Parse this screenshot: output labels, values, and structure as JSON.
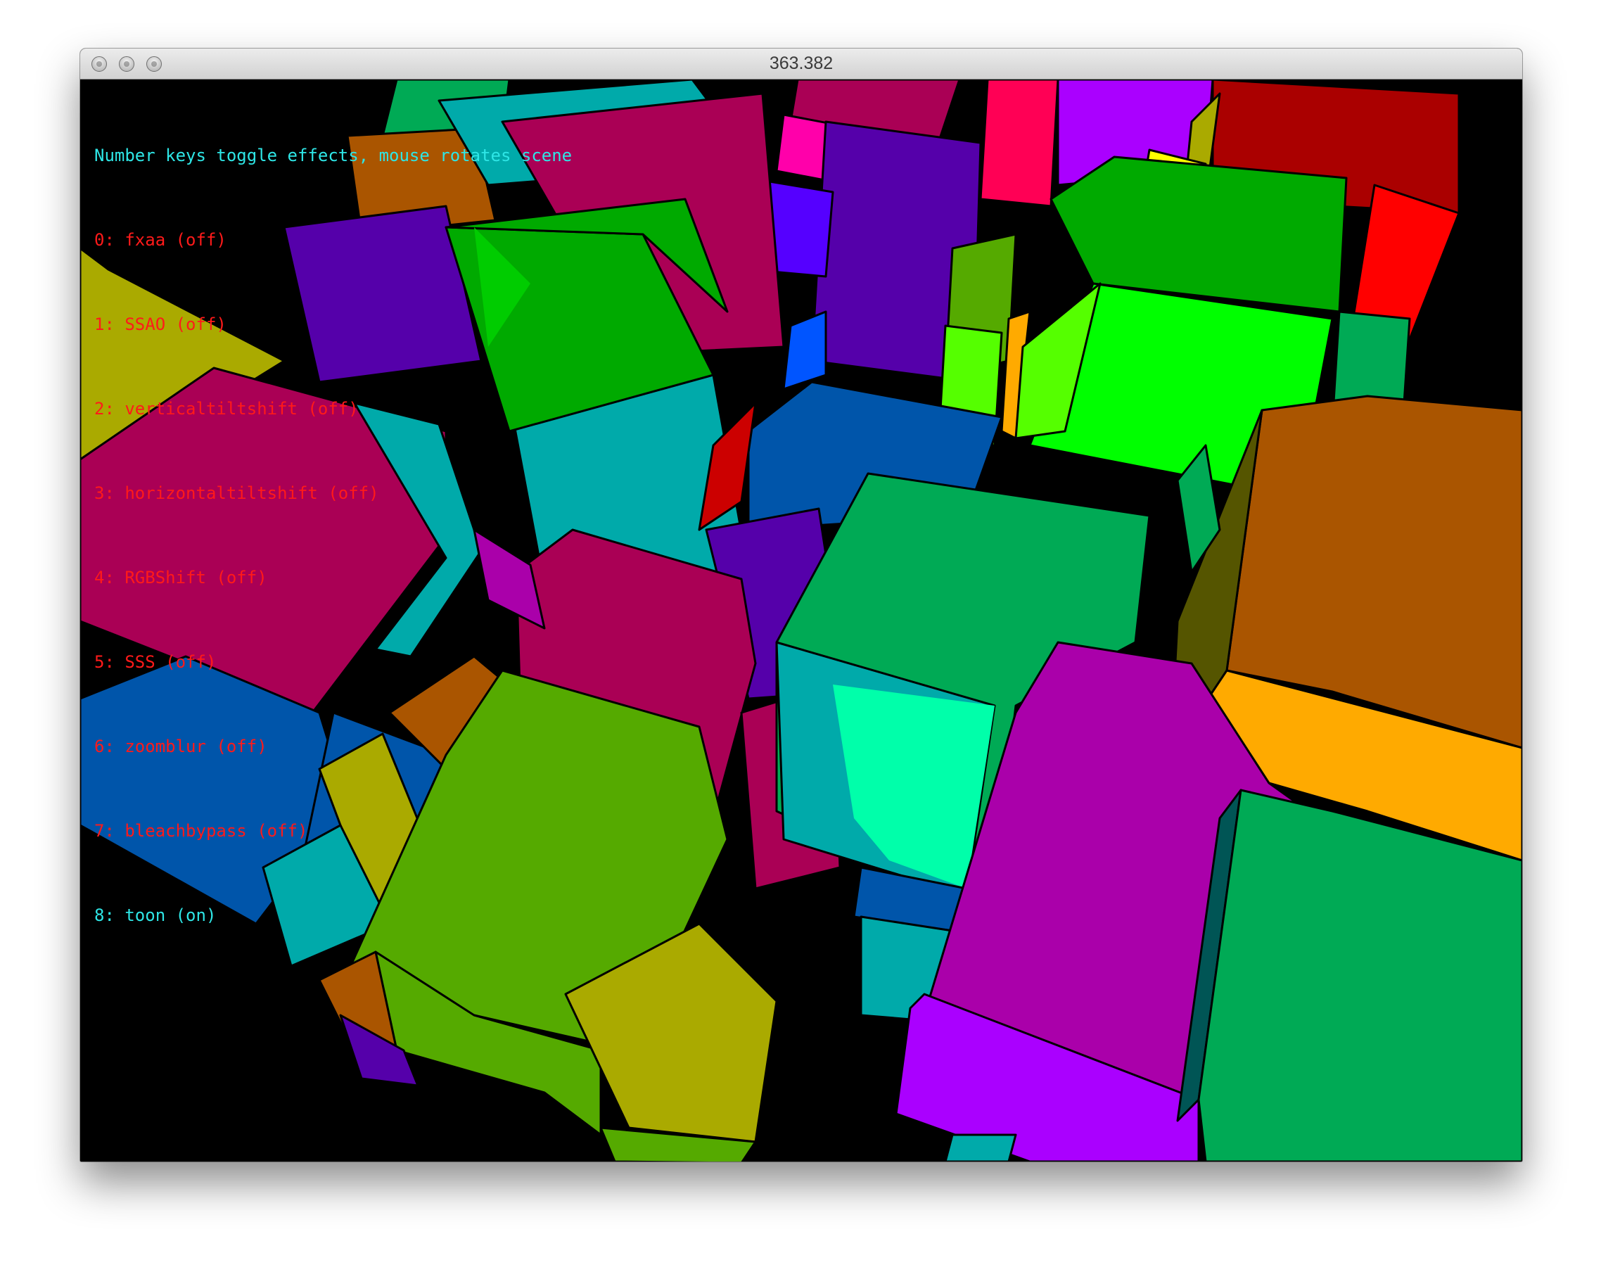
{
  "window": {
    "title": "363.382",
    "buttons": [
      "close-icon",
      "minimize-icon",
      "zoom-icon"
    ]
  },
  "overlay": {
    "instructions": "Number keys toggle effects, mouse rotates scene",
    "effects": [
      {
        "label": "0: fxaa (off)",
        "state": "off"
      },
      {
        "label": "1: SSAO (off)",
        "state": "off"
      },
      {
        "label": "2: verticaltiltshift (off)",
        "state": "off"
      },
      {
        "label": "3: horizontaltiltshift (off)",
        "state": "off"
      },
      {
        "label": "4: RGBShift (off)",
        "state": "off"
      },
      {
        "label": "5: SSS (off)",
        "state": "off"
      },
      {
        "label": "6: zoomblur (off)",
        "state": "off"
      },
      {
        "label": "7: bleachbypass (off)",
        "state": "off"
      },
      {
        "label": "8: toon (on)",
        "state": "on"
      }
    ]
  },
  "colors": {
    "on": "#2ee6e6",
    "off": "#ff1a1a",
    "background": "#000000"
  }
}
